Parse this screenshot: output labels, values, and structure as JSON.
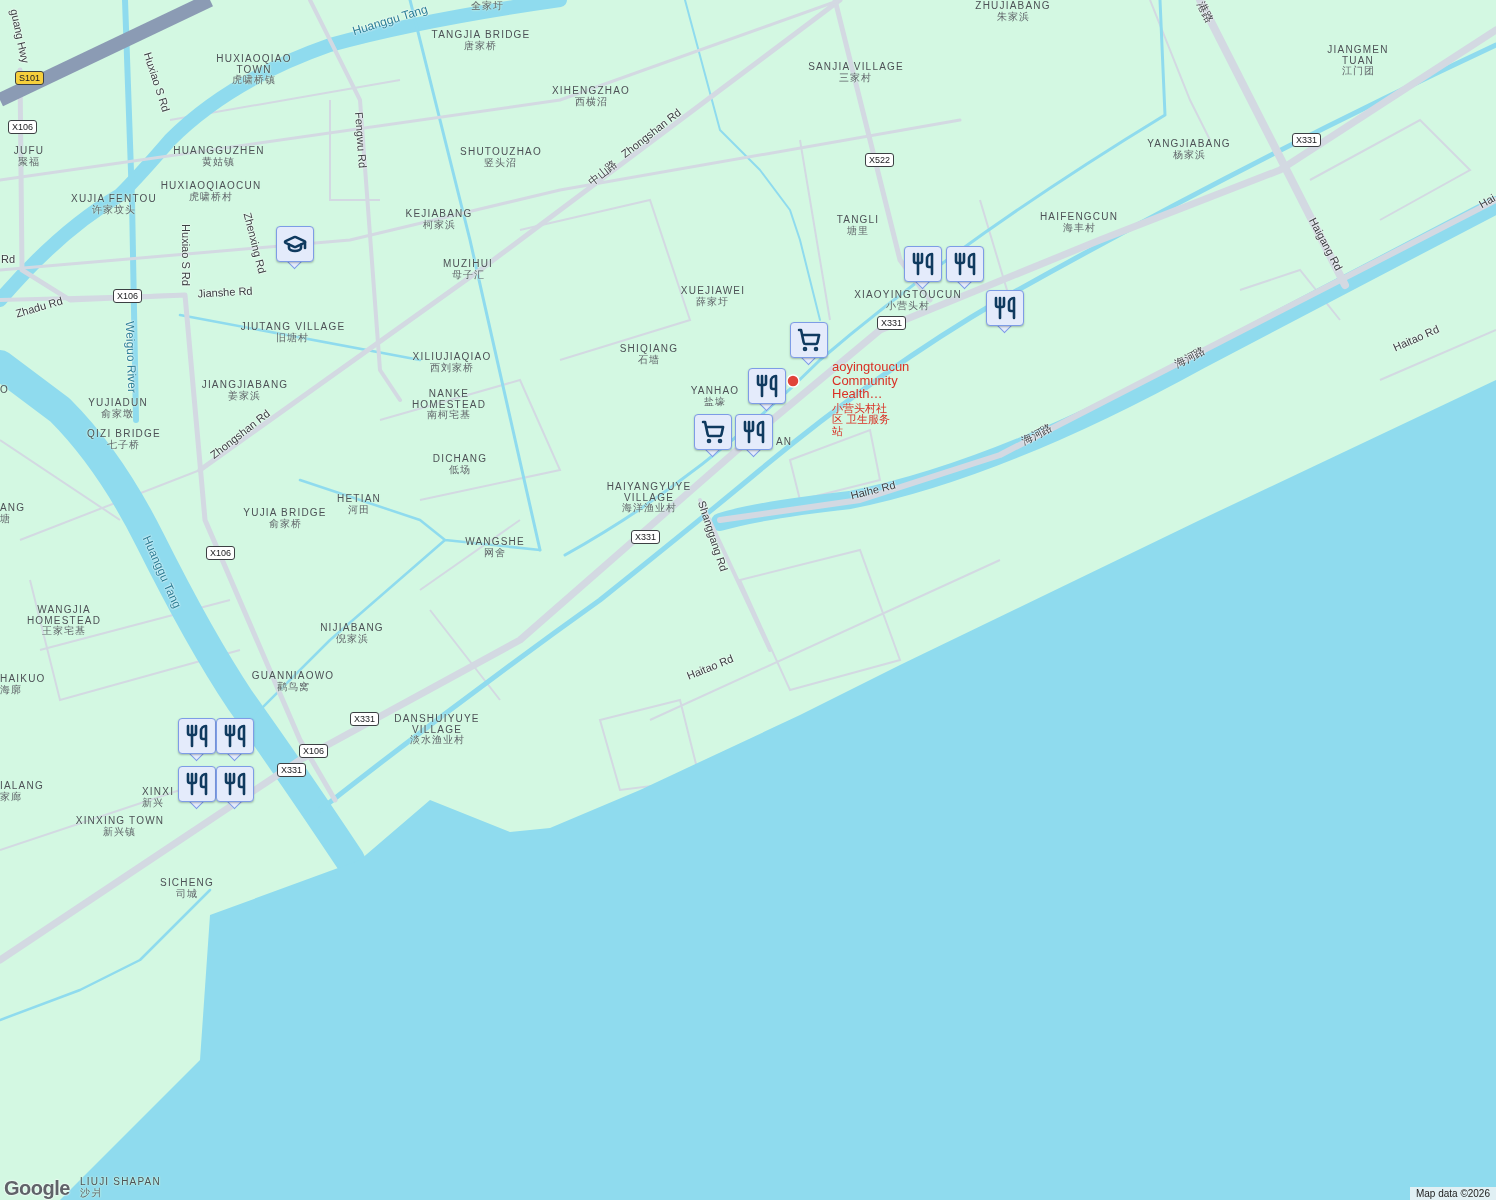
{
  "places": [
    {
      "local": "全家圩"
    },
    {
      "name": "TANGJIA BRIDGE",
      "local": "唐家桥"
    },
    {
      "name": "HUXIAOQIAO TOWN",
      "local": "虎啸桥镇"
    },
    {
      "name": "XIHENGZHAO",
      "local": "西横沼"
    },
    {
      "name": "SANJIA VILLAGE",
      "local": "三家村"
    },
    {
      "name": "ZHUJIABANG",
      "local": "朱家浜"
    },
    {
      "name": "JIANGMEN TUAN",
      "local": "江门团"
    },
    {
      "name": "JUFU",
      "local": "聚福"
    },
    {
      "name": "HUANGGUZHEN",
      "local": "黄姑镇"
    },
    {
      "name": "SHUTOUZHAO",
      "local": "竖头沼"
    },
    {
      "name": "YANGJIABANG",
      "local": "杨家浜"
    },
    {
      "name": "HUXIAOQIAOCUN",
      "local": "虎啸桥村"
    },
    {
      "name": "XUJIA FENTOU",
      "local": "许家坟头"
    },
    {
      "name": "KEJIABANG",
      "local": "柯家浜"
    },
    {
      "name": "TANGLI",
      "local": "塘里"
    },
    {
      "name": "HAIFENGCUN",
      "local": "海丰村"
    },
    {
      "name": "MUZIHUI",
      "local": "母子汇"
    },
    {
      "name": "XUEJIAWEI",
      "local": "薛家圩"
    },
    {
      "name": "XIAOYINGTOUCUN",
      "local": "小营头村"
    },
    {
      "name": "JIUTANG VILLAGE",
      "local": "旧塘村"
    },
    {
      "name": "SHIQIANG",
      "local": "石墙"
    },
    {
      "name": "XILIUJIAQIAO",
      "local": "西刘家桥"
    },
    {
      "name": "JIANGJIABANG",
      "local": "姜家浜"
    },
    {
      "name": "NANKE HOMESTEAD",
      "local": "南柯宅基"
    },
    {
      "name": "YANHAO",
      "local": "盐壕"
    },
    {
      "name": "YUJIADUN",
      "local": "俞家墩"
    },
    {
      "name": "QIZI BRIDGE",
      "local": "七子桥"
    },
    {
      "name": "DICHANG",
      "local": "低场"
    },
    {
      "name": "HETIAN",
      "local": "河田"
    },
    {
      "name": "HAIYANGYUYE VILLAGE",
      "local": "海洋渔业村"
    },
    {
      "name": "YUJIA BRIDGE",
      "local": "俞家桥"
    },
    {
      "name": "WANGSHE",
      "local": "网舍"
    },
    {
      "name": "WANGJIA HOMESTEAD",
      "local": "王家宅基"
    },
    {
      "name": "NIJIABANG",
      "local": "倪家浜"
    },
    {
      "name": "GUANNIAOWO",
      "local": "鹳鸟窝"
    },
    {
      "name": "DANSHUIYUYE VILLAGE",
      "local": "淡水渔业村"
    },
    {
      "name": "XINXING TOWN",
      "local": "新兴镇"
    },
    {
      "name": "SICHENG",
      "local": "司城"
    },
    {
      "name": "O"
    },
    {
      "name": "ANG",
      "local": "塘"
    },
    {
      "name": "HAIKUO",
      "local": "海廓"
    },
    {
      "name": "IALANG",
      "local": "家廊"
    },
    {
      "name": "XINXI",
      "local": "新兴"
    },
    {
      "name": "AN"
    },
    {
      "name": "LIUJI SHAPAN",
      "local": "沙爿"
    }
  ],
  "road_labels": [
    {
      "text": "guang Hwy",
      "kind": "road"
    },
    {
      "text": "Huanggu Tang",
      "kind": "water"
    },
    {
      "text": "Huxiao S Rd",
      "kind": "road"
    },
    {
      "text": "Fengwu Rd",
      "kind": "road"
    },
    {
      "text": "Zhongshan Rd",
      "kind": "road"
    },
    {
      "text": "中山路",
      "kind": "road"
    },
    {
      "text": "Zhenxing Rd",
      "kind": "road"
    },
    {
      "text": "Huxiao S Rd",
      "kind": "road"
    },
    {
      "text": "Jianshe Rd",
      "kind": "road"
    },
    {
      "text": "Zhadu Rd",
      "kind": "road"
    },
    {
      "text": "Rd",
      "kind": "road"
    },
    {
      "text": "Weiguo River",
      "kind": "water"
    },
    {
      "text": "Zhongshan Rd",
      "kind": "road"
    },
    {
      "text": "Huanggu Tang",
      "kind": "water"
    },
    {
      "text": "Shanggang Rd",
      "kind": "road"
    },
    {
      "text": "Haihe Rd",
      "kind": "road"
    },
    {
      "text": "海河路",
      "kind": "road"
    },
    {
      "text": "海河路",
      "kind": "road"
    },
    {
      "text": "Haigang Rd",
      "kind": "road"
    },
    {
      "text": "Haitao Rd",
      "kind": "road"
    },
    {
      "text": "Haitao Rd",
      "kind": "road"
    },
    {
      "text": "港路",
      "kind": "road"
    },
    {
      "text": "Hai",
      "kind": "road"
    }
  ],
  "shields": [
    {
      "label": "S101",
      "kind": "provincial"
    },
    {
      "label": "X106",
      "kind": "county"
    },
    {
      "label": "X106",
      "kind": "county"
    },
    {
      "label": "X106",
      "kind": "county"
    },
    {
      "label": "X106",
      "kind": "county"
    },
    {
      "label": "X331",
      "kind": "county"
    },
    {
      "label": "X331",
      "kind": "county"
    },
    {
      "label": "X331",
      "kind": "county"
    },
    {
      "label": "X331",
      "kind": "county"
    },
    {
      "label": "X331",
      "kind": "county"
    },
    {
      "label": "X522",
      "kind": "county"
    }
  ],
  "markers": [
    {
      "kind": "school"
    },
    {
      "kind": "restaurant"
    },
    {
      "kind": "restaurant"
    },
    {
      "kind": "restaurant"
    },
    {
      "kind": "shopping"
    },
    {
      "kind": "restaurant"
    },
    {
      "kind": "shopping"
    },
    {
      "kind": "restaurant"
    },
    {
      "kind": "restaurant"
    },
    {
      "kind": "restaurant"
    },
    {
      "kind": "restaurant"
    },
    {
      "kind": "restaurant"
    }
  ],
  "highlighted_place": {
    "name": "aoyingtoucun Community Health…",
    "local": "小营头村社区 卫生服务站"
  },
  "footer": {
    "logo": "Google",
    "attribution": "Map data ©2026"
  }
}
